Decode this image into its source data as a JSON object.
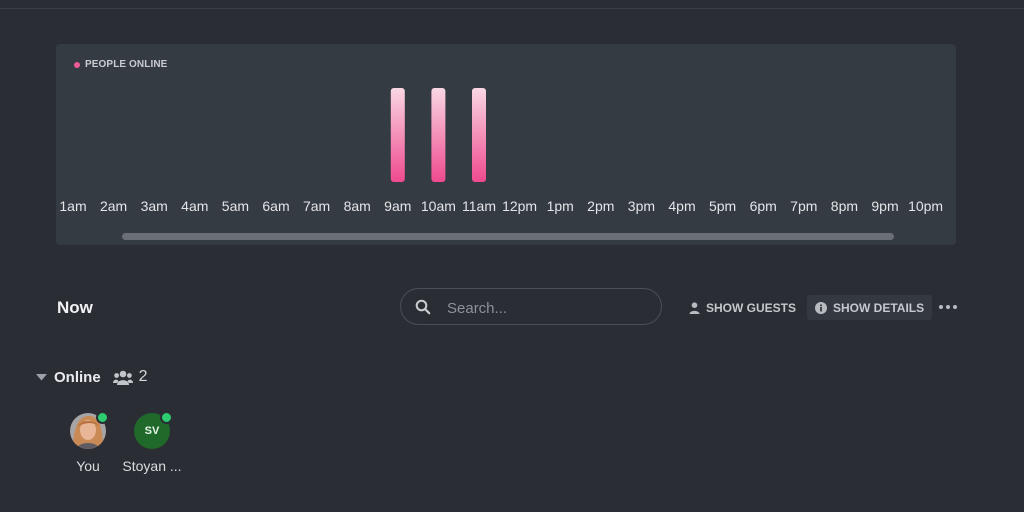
{
  "chart_data": {
    "type": "bar",
    "legend": "PEOPLE ONLINE",
    "categories": [
      "1am",
      "2am",
      "3am",
      "4am",
      "5am",
      "6am",
      "7am",
      "8am",
      "9am",
      "10am",
      "11am",
      "12pm",
      "1pm",
      "2pm",
      "3pm",
      "4pm",
      "5pm",
      "6pm",
      "7pm",
      "8pm",
      "9pm",
      "10pm"
    ],
    "values": [
      0,
      0,
      0,
      0,
      0,
      0,
      0,
      0,
      1,
      1,
      1,
      0,
      0,
      0,
      0,
      0,
      0,
      0,
      0,
      0,
      0,
      0
    ],
    "series_color": "#ef5b95",
    "gradient_top": "#f9d7e4",
    "gradient_bottom": "#ef4a8d"
  },
  "main": {
    "section_title": "Now",
    "search_placeholder": "Search...",
    "show_guests_label": "SHOW GUESTS",
    "show_details_label": "SHOW DETAILS"
  },
  "online": {
    "label": "Online",
    "count": "2",
    "users": [
      {
        "name": "You",
        "initials": ""
      },
      {
        "name": "Stoyan ...",
        "initials": "SV"
      }
    ]
  },
  "colors": {
    "background": "#2a2d34",
    "panel": "#353b42",
    "status_online": "#2ecc71",
    "avatar_sv": "#1f6a2a"
  }
}
